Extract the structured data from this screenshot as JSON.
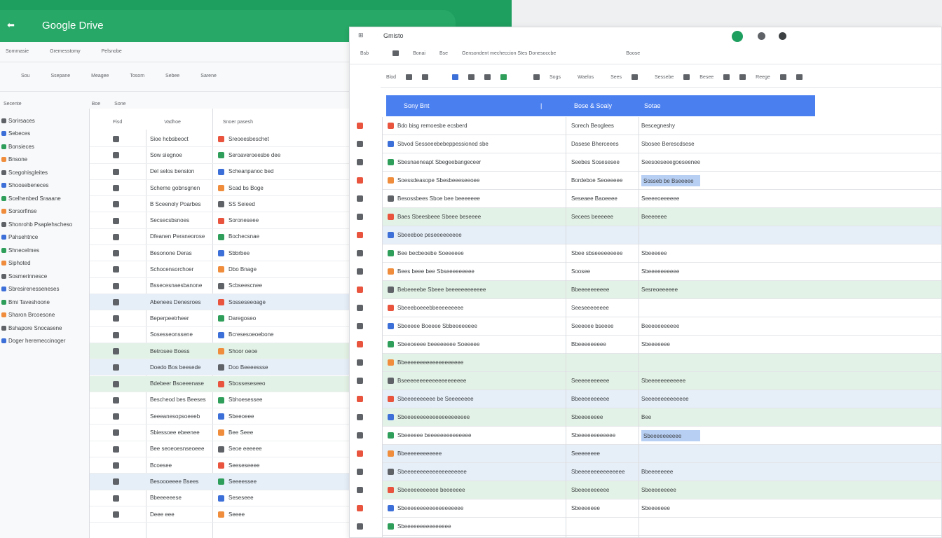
{
  "colors": {
    "brand_green": "#1e9e5f",
    "header_blue": "#4a7ff0",
    "row_green": "#e3f2e6",
    "row_blue": "#e6eef8",
    "sel_blue": "#b8cff4",
    "icon_red": "#e8543d",
    "icon_green": "#2e9e5a",
    "icon_blue": "#3d6fd8",
    "icon_orange": "#ef8d3c",
    "icon_gray": "#5f6368"
  },
  "back_window": {
    "title": "Google Drive",
    "menu": [
      "Sommasie",
      "Gremesstomy",
      "Pelsnobe"
    ],
    "toolbar": [
      "Sou",
      "Ssepane",
      "Meagee",
      "Tosom",
      "Sebee",
      "Sarene"
    ],
    "search_label": "Secente",
    "tabs": [
      "Boe",
      "Sone"
    ],
    "col_headers": [
      "Fisd",
      "Vadhoe",
      "Snoer pasesh"
    ],
    "sidebar": [
      "Sorirsaces",
      "Sebeces",
      "Bonsieces",
      "Bnsone",
      "Scegohisgleites",
      "Shoosebeneces",
      "Scelhenbed Sraaane",
      "Sorsorfinse",
      "Shonrohb Psaplehscheso",
      "Pahsehtnce",
      "Shnecelmes",
      "Siphoted",
      "Sosmerinnesce",
      "Sbresirenesseneses",
      "Bmi Taveshoone",
      "Sharon Brcoesone",
      "Bshapore Snocasene",
      "Doger heremeccinoger"
    ],
    "rows": [
      {
        "a": "Sioe hcbsbeoct",
        "b": "Sreoeesbeschet"
      },
      {
        "a": "Sow siegnoe",
        "b": "Seroaveroeesbe dee"
      },
      {
        "a": "Del selos bension",
        "b": "Scheanpanoc bed"
      },
      {
        "a": "Scheme gobnsgnen",
        "b": "Scad bs Boge"
      },
      {
        "a": "B Sceenoly Poarbes",
        "b": "SS Seieed"
      },
      {
        "a": "Secsecsbsnoes",
        "b": "Soroneseee"
      },
      {
        "a": "Dfeanen Peraneorose",
        "b": "Bochecsnae"
      },
      {
        "a": "Besonone Deras",
        "b": "Sbbrbee"
      },
      {
        "a": "Schocensorchoer",
        "b": "Dbo Bnage"
      },
      {
        "a": "Bssecesnaesbanone",
        "b": "Scbseescnee"
      },
      {
        "a": "Abenees Denesroes",
        "b": "Sosseseeoage"
      },
      {
        "a": "Beperpeetrheer",
        "b": "Daregoseo"
      },
      {
        "a": "Sosesseonssene",
        "b": "Bcresesoeoebone"
      },
      {
        "a": "Betrosee Boess",
        "b": "Shoor oeoe"
      },
      {
        "a": "Doedo Bos beesede",
        "b": "Doo Beeeessse"
      },
      {
        "a": "Bdebeer Bsoeeenase",
        "b": "Sbosseseseeo"
      },
      {
        "a": "Bescheod bes Beeses",
        "b": "Sbhoesessee"
      },
      {
        "a": "Seeeanesopsoeeeb",
        "b": "Sbeeoeee"
      },
      {
        "a": "Sbiessoee ebeenee",
        "b": "Bee Seee"
      },
      {
        "a": "Bee seoeoesnseoeee",
        "b": "Seoe eeeeee"
      },
      {
        "a": "Bcoesee",
        "b": "Seeseseeee"
      },
      {
        "a": "Besoooeeee Bsees",
        "b": "Seeeessee"
      },
      {
        "a": "Bbeeeeeese",
        "b": "Seseseee"
      },
      {
        "a": "Deee eee",
        "b": "Seeee"
      }
    ]
  },
  "front_window": {
    "title": "Gmisto",
    "menu_left": "Bsb",
    "menu": [
      "Bonai",
      "Bse",
      "Gensondent mecheccion Stes Donesoccbe",
      "Boose"
    ],
    "toolbar": [
      "Blod",
      "Sogs",
      "Waelos",
      "Sees",
      "Sessebe",
      "Besee",
      "Reege"
    ],
    "header_cells": [
      "Sony Bnt",
      "Bose & Soaly",
      "Sotae"
    ],
    "rows": [
      {
        "a": "Bdo bisg remoesbe ecsberd",
        "b": "Sorech Beoglees",
        "c": "Bescegneshy"
      },
      {
        "a": "Sbvod Sesseeebebeppessioned sbe",
        "b": "Dasese Bherceees",
        "c": "Sbosee Berescdsese"
      },
      {
        "a": "Sbesnaeneapt Sbegeebangeceer",
        "b": "Seebes Sosesesee",
        "c": "Seesoeseeegoeseenee"
      },
      {
        "a": "Soessdeasope Sbesbeeeseeoee",
        "b": "Bordeboe Seoeeeee",
        "c": "Sosseb be Bseeeee"
      },
      {
        "a": "Besossbees Sboe bee beeeeeee",
        "b": "Seseaee Baoeeee",
        "c": "Seeeeoeeeeee"
      },
      {
        "a": "Baes Sbeesbeee Sbeee beseeee",
        "b": "Secees beeeeee",
        "c": "Beeeeeee"
      },
      {
        "a": "Sbeeeboe peseeeeeeeee",
        "b": "",
        "c": ""
      },
      {
        "a": "Bee becbeoebe Soeeeeee",
        "b": "Sbee sbseeeeeeeee",
        "c": "Sbeeeeee"
      },
      {
        "a": "Bees beee bee Sbseeeeeeeee",
        "b": "Soosee",
        "c": "Sbeeeeeeeeee"
      },
      {
        "a": "Bebeeeebe Sbeee beeeeeeeeeeee",
        "b": "Bbeeeeeeeeee",
        "c": "Sesreoeeeeee"
      },
      {
        "a": "Sbeeeboeeebbeeeeeeeee",
        "b": "Seeseeeeeeee",
        "c": ""
      },
      {
        "a": "Sbeeeee Boeeee Sbbeeeeeeee",
        "b": "Seeeeee bseeee",
        "c": "Beeeeeeeeeee"
      },
      {
        "a": "Sbeeoeeee beeeeeeee Soeeeee",
        "b": "Bbeeeeeeeee",
        "c": "Sbeeeeeee"
      },
      {
        "a": "Bbeeeeeeeeeeeeeeeeeee",
        "b": "",
        "c": ""
      },
      {
        "a": "Bseeeeeeeeeeeeeeeeeeee",
        "b": "Seeeeeeeeeee",
        "c": "Sbeeeeeeeeeeee"
      },
      {
        "a": "Sbeeeeeeeeee be Seeeeeeee",
        "b": "Bbeeeeeeeeee",
        "c": "Seeeeeeeeeeeeee"
      },
      {
        "a": "Sbeeeeeeeeeeeeeeeeeeeee",
        "b": "Sbeeeeeeee",
        "c": "Bee"
      },
      {
        "a": "Sbeeeeee beeeeeeeeeeeeee",
        "b": "Sbeeeeeeeeeeee",
        "c": "Sbeeeeeeeeee"
      },
      {
        "a": "Bbeeeeeeeeeeee",
        "b": "Seeeeeeee",
        "c": ""
      },
      {
        "a": "Sbeeeeeeeeeeeeeeeeeeee",
        "b": "Sbeeeeeeeeeeeeeee",
        "c": "Bbeeeeeeee"
      },
      {
        "a": "Sbeeeeeeeeeee beeeeeee",
        "b": "Sbeeeeeeeeee",
        "c": "Sbeeeeeeeee"
      },
      {
        "a": "Sbeeeeeeeeeeeeeeeeeee",
        "b": "Sbeeeeeee",
        "c": "Sbeeeeeee"
      },
      {
        "a": "Sbeeeeeeeeeeeeeee",
        "b": "",
        "c": ""
      }
    ]
  }
}
